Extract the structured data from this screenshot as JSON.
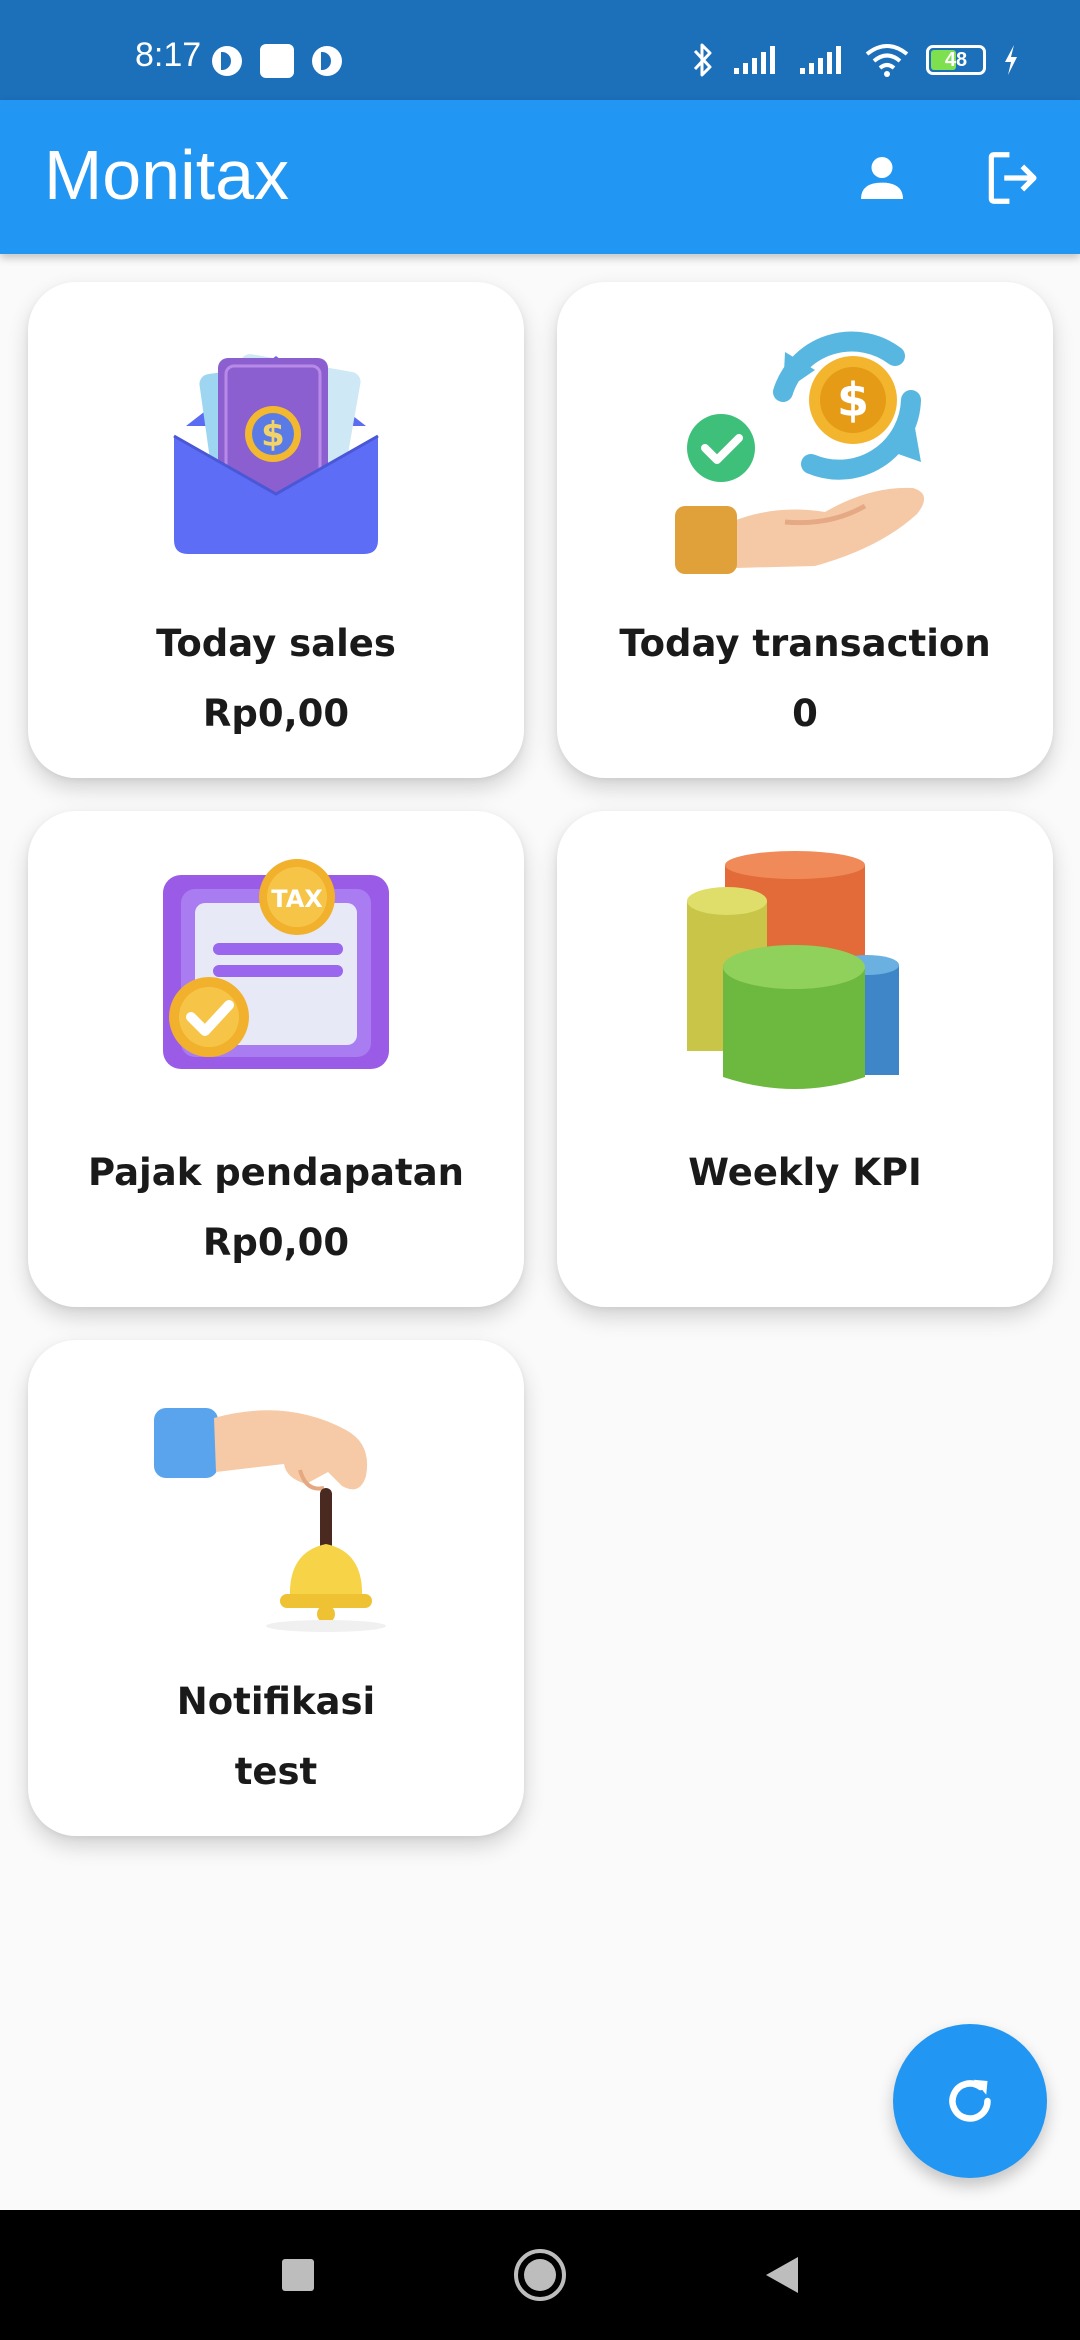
{
  "status_bar": {
    "time": "8:17",
    "battery_level": "48",
    "icons": [
      "app-icon",
      "notification-icon",
      "app-icon",
      "bluetooth-icon",
      "signal-icon",
      "signal-icon",
      "wifi-icon",
      "battery-icon",
      "charging-icon"
    ]
  },
  "app_bar": {
    "title": "Monitax",
    "actions": [
      "person-icon",
      "logout-icon"
    ]
  },
  "cards": [
    {
      "title": "Today sales",
      "value": "Rp0,00",
      "icon": "money-envelope-icon"
    },
    {
      "title": "Today transaction",
      "value": "0",
      "icon": "hand-coin-exchange-icon"
    },
    {
      "title": "Pajak pendapatan",
      "value": "Rp0,00",
      "icon": "tax-document-icon"
    },
    {
      "title": "Weekly KPI",
      "value": "",
      "icon": "pie-chart-icon"
    },
    {
      "title": "Notifikasi",
      "value": "test",
      "icon": "hand-bell-icon"
    }
  ],
  "fab": {
    "icon": "refresh-icon"
  },
  "nav_bar": {
    "buttons": [
      "recents-icon",
      "home-icon",
      "back-icon"
    ]
  },
  "colors": {
    "status_bar": "#1c6fb9",
    "app_bar": "#2196f3",
    "background": "#fafafa",
    "card": "#ffffff",
    "text": "#1a1a1a"
  }
}
